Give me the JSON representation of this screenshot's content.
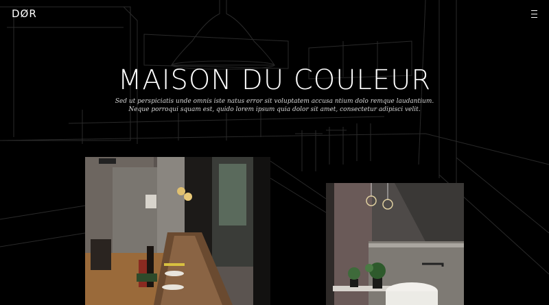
{
  "brand": {
    "logo": "DØR"
  },
  "nav": {
    "menu_icon": "hamburger-menu-icon"
  },
  "hero": {
    "title": "MAISON DU COULEUR",
    "subtitle_line1": "Sed ut perspiciatis unde omnis iste natus error sit voluptatem accusa ntium dolo remque laudantium.",
    "subtitle_line2": "Neque porroqui squam est, quido lorem ipsum quia dolor sit amet, consectetur adipisci velit."
  },
  "gallery": {
    "images": [
      {
        "name": "restaurant-interior-photo"
      },
      {
        "name": "bathroom-interior-photo"
      }
    ]
  },
  "colors": {
    "background": "#000000",
    "text": "#ffffff",
    "subtitle": "#d8d8d8"
  }
}
